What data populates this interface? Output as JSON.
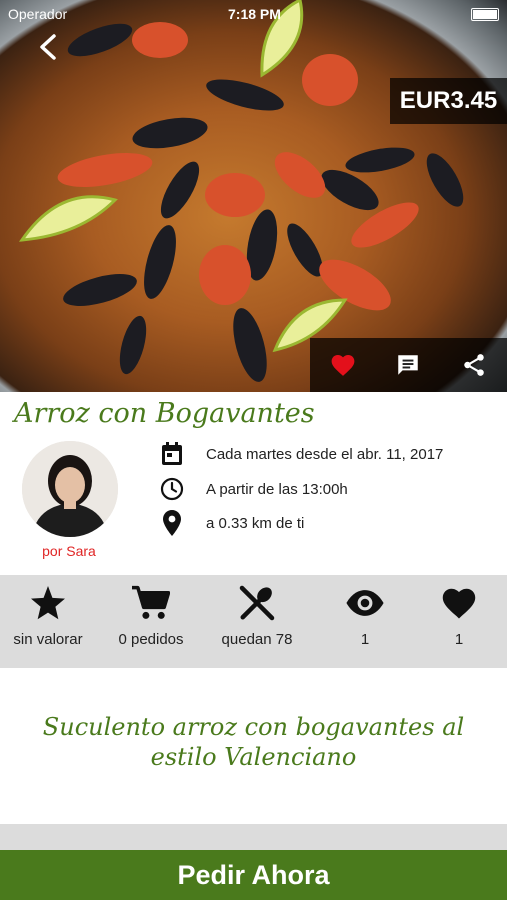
{
  "status_bar": {
    "carrier": "Operador",
    "time": "7:18 PM"
  },
  "header": {
    "price": "EUR3.45"
  },
  "dish": {
    "title": "Arroz con Bogavantes",
    "author": "por Sara",
    "schedule": "Cada martes desde el abr. 11, 2017",
    "time": "A partir de las 13:00h",
    "distance": "a 0.33 km de ti",
    "description": "Suculento arroz con bogavantes al estilo Valenciano"
  },
  "stats": [
    {
      "icon": "star-icon",
      "label": "sin valorar"
    },
    {
      "icon": "cart-icon",
      "label": "0 pedidos"
    },
    {
      "icon": "utensils-icon",
      "label": "quedan 78"
    },
    {
      "icon": "eye-icon",
      "label": "1"
    },
    {
      "icon": "heart-icon",
      "label": "1"
    }
  ],
  "cta": {
    "label": "Pedir Ahora"
  },
  "colors": {
    "brand_green": "#4a7a1c",
    "favorite_red": "#e3101b",
    "author_red": "#e02525"
  }
}
